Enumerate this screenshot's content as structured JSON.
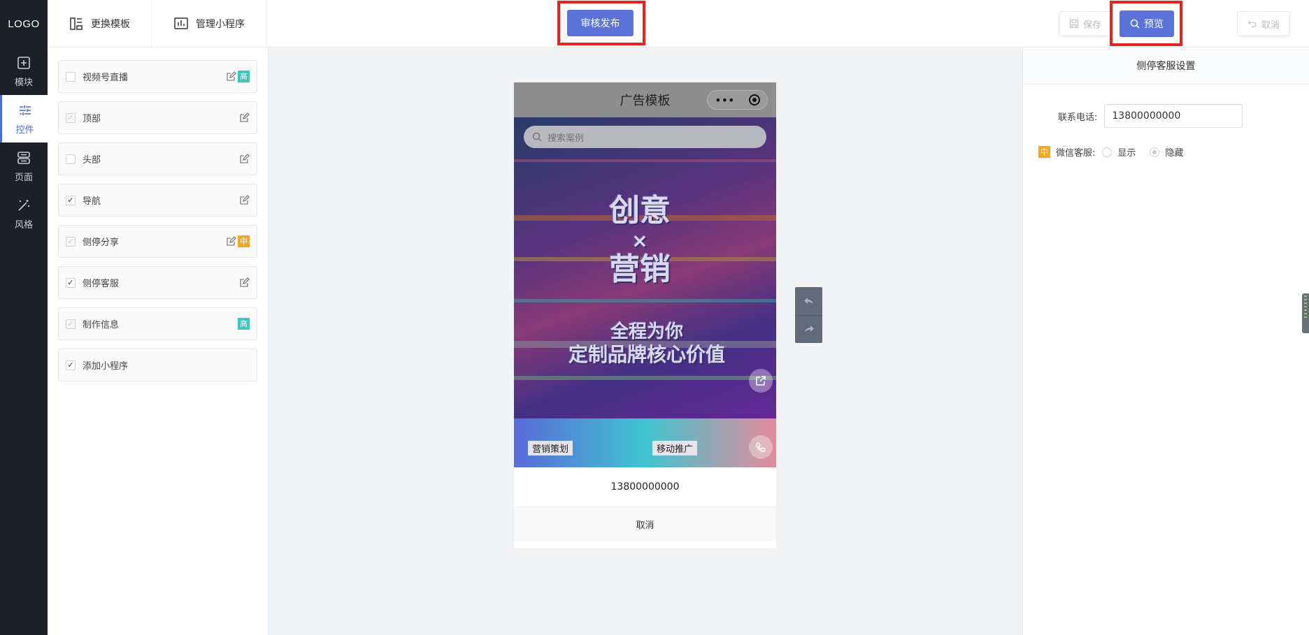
{
  "rail": {
    "logo": "LOGO",
    "items": [
      {
        "label": "模块",
        "icon": "plus-square-icon"
      },
      {
        "label": "控件",
        "icon": "sliders-icon"
      },
      {
        "label": "页面",
        "icon": "pages-icon"
      },
      {
        "label": "风格",
        "icon": "magic-wand-icon"
      }
    ],
    "active": "控件"
  },
  "topbar": {
    "tabs": [
      {
        "label": "更换模板",
        "icon": "template-icon"
      },
      {
        "label": "管理小程序",
        "icon": "bar-chart-icon"
      }
    ],
    "publish_label": "审核发布",
    "save_label": "保存",
    "preview_label": "预览",
    "cancel_label": "取消"
  },
  "widgets": [
    {
      "label": "视频号直播",
      "checked": false,
      "editable": true,
      "tag": "高",
      "tag_type": "hi"
    },
    {
      "label": "顶部",
      "checked": true,
      "disabled": true,
      "editable": true,
      "tag": ""
    },
    {
      "label": "头部",
      "checked": false,
      "editable": true,
      "tag": ""
    },
    {
      "label": "导航",
      "checked": true,
      "editable": true,
      "tag": ""
    },
    {
      "label": "侧停分享",
      "checked": true,
      "disabled": true,
      "editable": true,
      "tag": "中",
      "tag_type": "mid"
    },
    {
      "label": "侧停客服",
      "checked": true,
      "editable": true,
      "tag": ""
    },
    {
      "label": "制作信息",
      "checked": true,
      "disabled": true,
      "editable": false,
      "tag": "高",
      "tag_type": "hi"
    },
    {
      "label": "添加小程序",
      "checked": true,
      "editable": false,
      "tag": ""
    }
  ],
  "phone": {
    "title": "广告模板",
    "capsule_dots": "•••",
    "search_placeholder": "搜索案例",
    "slogan_line1": "创意",
    "slogan_x": "×",
    "slogan_line2": "营销",
    "slogan_line3": "全程为你",
    "slogan_line4": "定制品牌核心价值",
    "card1": "营销策划",
    "card2": "移动推广",
    "phone_number": "13800000000",
    "cancel": "取消"
  },
  "settings": {
    "title": "侧停客服设置",
    "phone_label": "联系电话:",
    "phone_value": "13800000000",
    "wechat_tag": "中",
    "wechat_label": "微信客服:",
    "option_show": "显示",
    "option_hide": "隐藏",
    "selected": "隐藏"
  },
  "colors": {
    "accent": "#5b73d8",
    "rail_bg": "#1d2026",
    "highlight": "#e8231d",
    "tag_high": "#3dc6c0",
    "tag_mid": "#f5a623"
  }
}
